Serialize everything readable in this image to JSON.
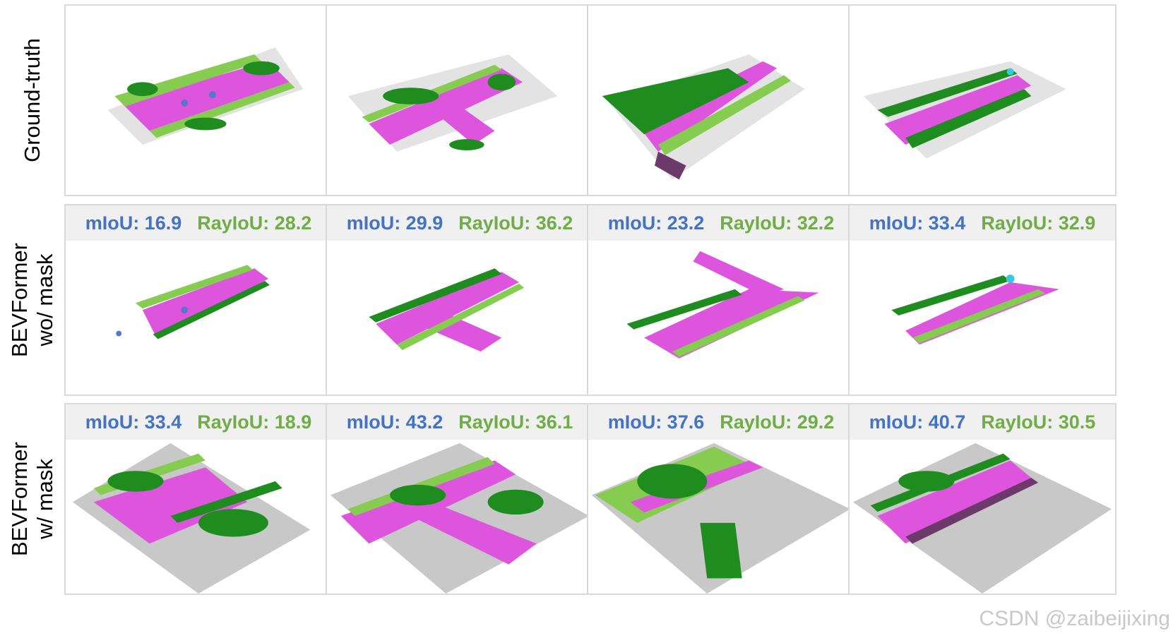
{
  "rows": [
    {
      "label_lines": [
        "Ground-truth"
      ],
      "has_metrics": false
    },
    {
      "label_lines": [
        "BEVFormer",
        "wo/ mask"
      ],
      "has_metrics": true
    },
    {
      "label_lines": [
        "BEVFormer",
        "w/ mask"
      ],
      "has_metrics": true
    }
  ],
  "metrics": {
    "row1": [
      {
        "miou": "mIoU: 16.9",
        "rayiou": "RayIoU: 28.2"
      },
      {
        "miou": "mIoU: 29.9",
        "rayiou": "RayIoU: 36.2"
      },
      {
        "miou": "mIoU: 23.2",
        "rayiou": "RayIoU: 32.2"
      },
      {
        "miou": "mIoU: 33.4",
        "rayiou": "RayIoU: 32.9"
      }
    ],
    "row2": [
      {
        "miou": "mIoU: 33.4",
        "rayiou": "RayIoU: 18.9"
      },
      {
        "miou": "mIoU: 43.2",
        "rayiou": "RayIoU: 36.1"
      },
      {
        "miou": "mIoU: 37.6",
        "rayiou": "RayIoU: 29.2"
      },
      {
        "miou": "mIoU: 40.7",
        "rayiou": "RayIoU: 30.5"
      }
    ]
  },
  "colors": {
    "road": "#dd55dd",
    "vegetation": "#1e8c1e",
    "terrain": "#86cc50",
    "manmade": "#c8c8c8",
    "sidewalk": "#6b3a6b",
    "car": "#5577cc",
    "metric_miou": "#4472c4",
    "metric_rayiou": "#70ad47"
  },
  "watermark": "CSDN @zaibeijixing"
}
